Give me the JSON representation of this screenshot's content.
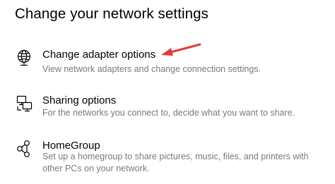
{
  "page": {
    "heading": "Change your network settings"
  },
  "options": [
    {
      "icon": "network-adapter-globe-icon",
      "title": "Change adapter options",
      "description": "View network adapters and change connection settings."
    },
    {
      "icon": "sharing-computers-icon",
      "title": "Sharing options",
      "description": "For the networks you connect to, decide what you want to share."
    },
    {
      "icon": "homegroup-icon",
      "title": "HomeGroup",
      "description": "Set up a homegroup to share pictures, music, files, and printers with other PCs on your network."
    }
  ],
  "annotation": {
    "arrow_color": "#e03b3b",
    "points_to": "Change adapter options"
  }
}
